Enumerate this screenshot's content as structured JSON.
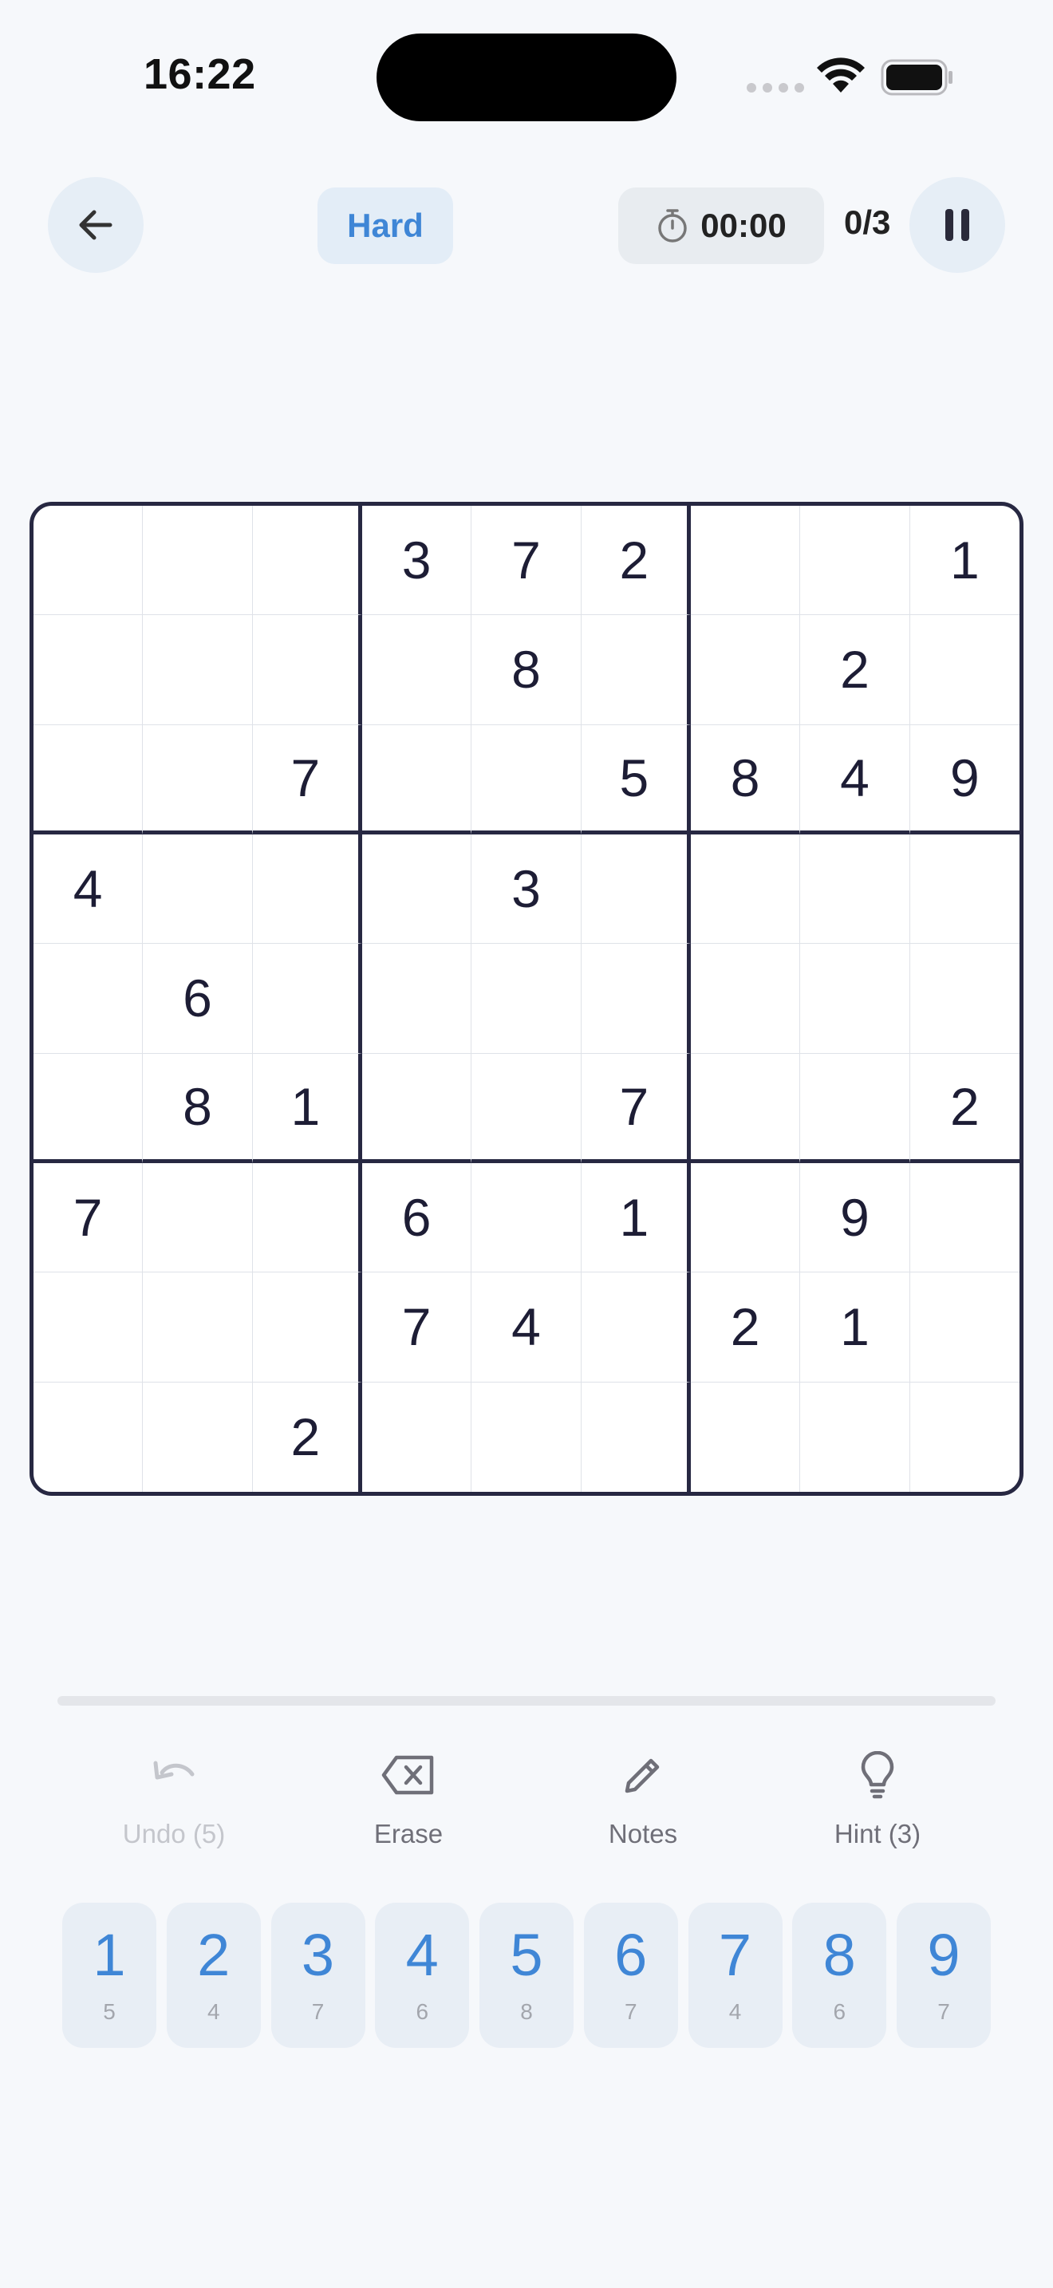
{
  "status_bar": {
    "time": "16:22"
  },
  "header": {
    "difficulty": "Hard",
    "timer": "00:00",
    "mistakes": "0/3"
  },
  "board": [
    [
      "",
      "",
      "",
      "3",
      "7",
      "2",
      "",
      "",
      "1"
    ],
    [
      "",
      "",
      "",
      "",
      "8",
      "",
      "",
      "2",
      ""
    ],
    [
      "",
      "",
      "7",
      "",
      "",
      "5",
      "8",
      "4",
      "9"
    ],
    [
      "4",
      "",
      "",
      "",
      "3",
      "",
      "",
      "",
      ""
    ],
    [
      "",
      "6",
      "",
      "",
      "",
      "",
      "",
      "",
      ""
    ],
    [
      "",
      "8",
      "1",
      "",
      "",
      "7",
      "",
      "",
      "2"
    ],
    [
      "7",
      "",
      "",
      "6",
      "",
      "1",
      "",
      "9",
      ""
    ],
    [
      "",
      "",
      "",
      "7",
      "4",
      "",
      "2",
      "1",
      ""
    ],
    [
      "",
      "",
      "2",
      "",
      "",
      "",
      "",
      "",
      ""
    ]
  ],
  "progress": 0,
  "tools": {
    "undo": "Undo (5)",
    "erase": "Erase",
    "notes": "Notes",
    "hint": "Hint (3)"
  },
  "numpad": [
    {
      "digit": "1",
      "remaining": "5"
    },
    {
      "digit": "2",
      "remaining": "4"
    },
    {
      "digit": "3",
      "remaining": "7"
    },
    {
      "digit": "4",
      "remaining": "6"
    },
    {
      "digit": "5",
      "remaining": "8"
    },
    {
      "digit": "6",
      "remaining": "7"
    },
    {
      "digit": "7",
      "remaining": "4"
    },
    {
      "digit": "8",
      "remaining": "6"
    },
    {
      "digit": "9",
      "remaining": "7"
    }
  ],
  "colors": {
    "accent": "#3f86d6",
    "board_border": "#272842",
    "background": "#f6f8fb"
  },
  "icons": {
    "back": "arrow-left-icon",
    "pause": "pause-icon",
    "timer": "stopwatch-icon",
    "undo": "undo-icon",
    "erase": "backspace-icon",
    "notes": "pencil-icon",
    "hint": "lightbulb-icon"
  }
}
